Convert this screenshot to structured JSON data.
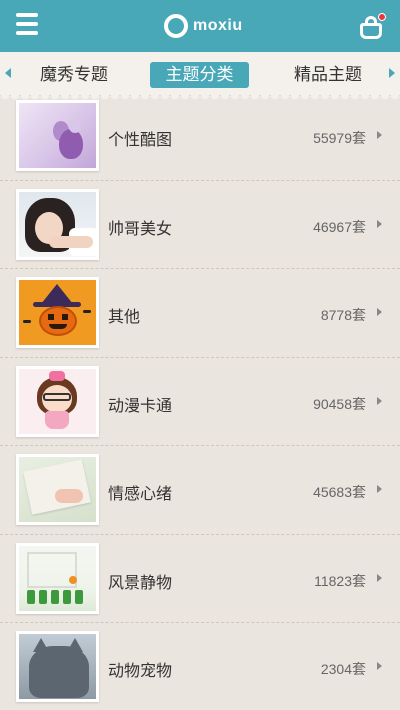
{
  "header": {
    "logo_text": "moxiu",
    "accent": "#49a8b8"
  },
  "tabs": [
    {
      "label": "魔秀专题"
    },
    {
      "label": "主题分类"
    },
    {
      "label": "精品主题"
    }
  ],
  "categories": [
    {
      "label": "个性酷图",
      "count": "55979套"
    },
    {
      "label": "帅哥美女",
      "count": "46967套"
    },
    {
      "label": "其他",
      "count": "8778套"
    },
    {
      "label": "动漫卡通",
      "count": "90458套"
    },
    {
      "label": "情感心绪",
      "count": "45683套"
    },
    {
      "label": "风景静物",
      "count": "11823套"
    },
    {
      "label": "动物宠物",
      "count": "2304套"
    }
  ]
}
